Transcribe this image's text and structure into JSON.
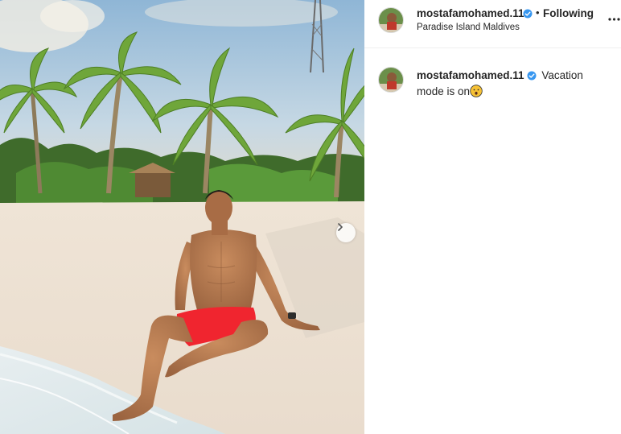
{
  "post": {
    "username": "mostafamohamed.11",
    "follow_status": "Following",
    "separator": "•",
    "location": "Paradise Island Maldives",
    "caption": {
      "username": "mostafamohamed.11",
      "text": "Vacation mode is on",
      "emoji": "hushed-face-emoji"
    },
    "photo_description_icon": "beach-photo",
    "icons": {
      "next": "chevron-right-icon",
      "more": "more-horizontal-icon",
      "verified": "verified-badge-icon"
    },
    "colors": {
      "verified": "#3897f0",
      "shorts": "#ff2d3a"
    }
  }
}
